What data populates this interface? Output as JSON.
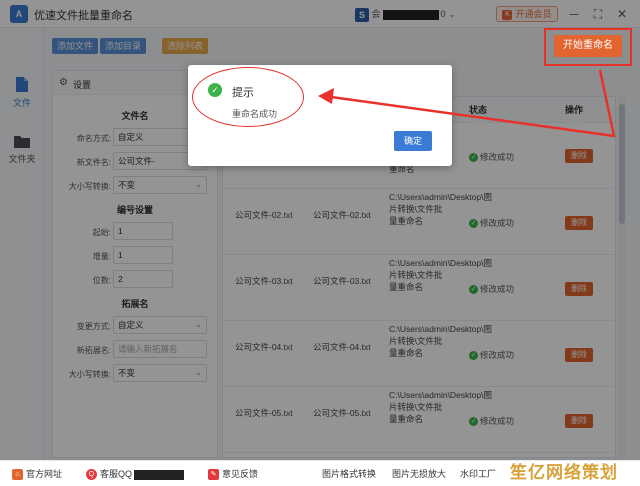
{
  "titlebar": {
    "app_title": "优速文件批量重命名",
    "user_prefix": "会",
    "user_suffix": "0",
    "vip_label": "开通会员",
    "logo_text": "A",
    "s_icon_text": "S"
  },
  "leftnav": {
    "items": [
      {
        "label": "文件",
        "active": true
      },
      {
        "label": "文件夹",
        "active": false
      }
    ]
  },
  "toolbar": {
    "add_file": "添加文件",
    "add_dir": "添加目录",
    "clear_list": "清除列表",
    "start_rename": "开始重命名"
  },
  "settings": {
    "header": "设置",
    "filename_section": "文件名",
    "naming_mode_label": "命名方式:",
    "naming_mode_value": "自定义",
    "new_name_label": "新文件名:",
    "new_name_value": "公司文件-",
    "case_label": "大小写转换:",
    "case_value": "不变",
    "numbering_section": "编号设置",
    "start_label": "起始:",
    "start_value": "1",
    "step_label": "增量:",
    "step_value": "1",
    "digits_label": "位数:",
    "digits_value": "2",
    "ext_section": "拓展名",
    "ext_mode_label": "变更方式:",
    "ext_mode_value": "自定义",
    "new_ext_label": "新拓展名:",
    "new_ext_placeholder": "请输入新拓展名",
    "ext_case_label": "大小写转换:",
    "ext_case_value": "不变"
  },
  "table": {
    "col_status": "状态",
    "col_action": "操作",
    "rows": [
      {
        "orig": "",
        "newname": "",
        "path": "",
        "status": "修改成功",
        "action": "删除"
      },
      {
        "orig": "公司文件-02.txt",
        "newname": "公司文件-02.txt",
        "path": "C:\\Users\\admin\\Desktop\\图片转换\\文件批量重命名",
        "status": "修改成功",
        "action": "删除"
      },
      {
        "orig": "公司文件-03.txt",
        "newname": "公司文件-03.txt",
        "path": "C:\\Users\\admin\\Desktop\\图片转换\\文件批量重命名",
        "status": "修改成功",
        "action": "删除"
      },
      {
        "orig": "公司文件-04.txt",
        "newname": "公司文件-04.txt",
        "path": "C:\\Users\\admin\\Desktop\\图片转换\\文件批量重命名",
        "status": "修改成功",
        "action": "删除"
      },
      {
        "orig": "公司文件-05.txt",
        "newname": "公司文件-05.txt",
        "path": "C:\\Users\\admin\\Desktop\\图片转换\\文件批量重命名",
        "status": "修改成功",
        "action": "删除"
      }
    ],
    "row0_path_tail": "重命名"
  },
  "dialog": {
    "title": "提示",
    "message": "重命名成功",
    "confirm": "确定"
  },
  "footer": {
    "official_site": "官方网址",
    "support_qq": "客服QQ",
    "feedback": "意见反馈",
    "img_convert": "图片格式转换",
    "img_compress": "图片无损放大",
    "watermark_factory": "水印工厂"
  },
  "watermark": "笙亿网络策划",
  "colors": {
    "accent": "#3a7bd5",
    "danger": "#e2652f",
    "success": "#3bb34a",
    "highlight": "#e8312a"
  }
}
